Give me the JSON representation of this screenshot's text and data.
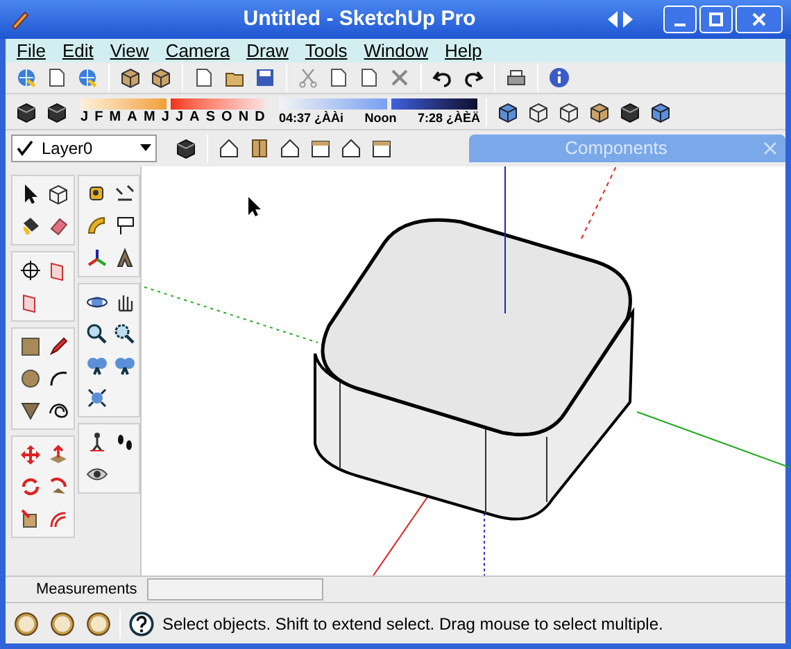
{
  "window": {
    "title": "Untitled - SketchUp Pro"
  },
  "menu": [
    "File",
    "Edit",
    "View",
    "Camera",
    "Draw",
    "Tools",
    "Window",
    "Help"
  ],
  "shadow_months": [
    "J",
    "F",
    "M",
    "A",
    "M",
    "J",
    "J",
    "A",
    "S",
    "O",
    "N",
    "D"
  ],
  "shadow_times": [
    "04:37 ¿ÀÀi",
    "Noon",
    "7:28 ¿ÀÈÄ"
  ],
  "layer": {
    "value": "Layer0",
    "checked": true
  },
  "components_panel": {
    "title": "Components"
  },
  "measurements": {
    "label": "Measurements"
  },
  "status_bar": {
    "message": "Select objects. Shift to extend select. Drag mouse to select multiple."
  }
}
